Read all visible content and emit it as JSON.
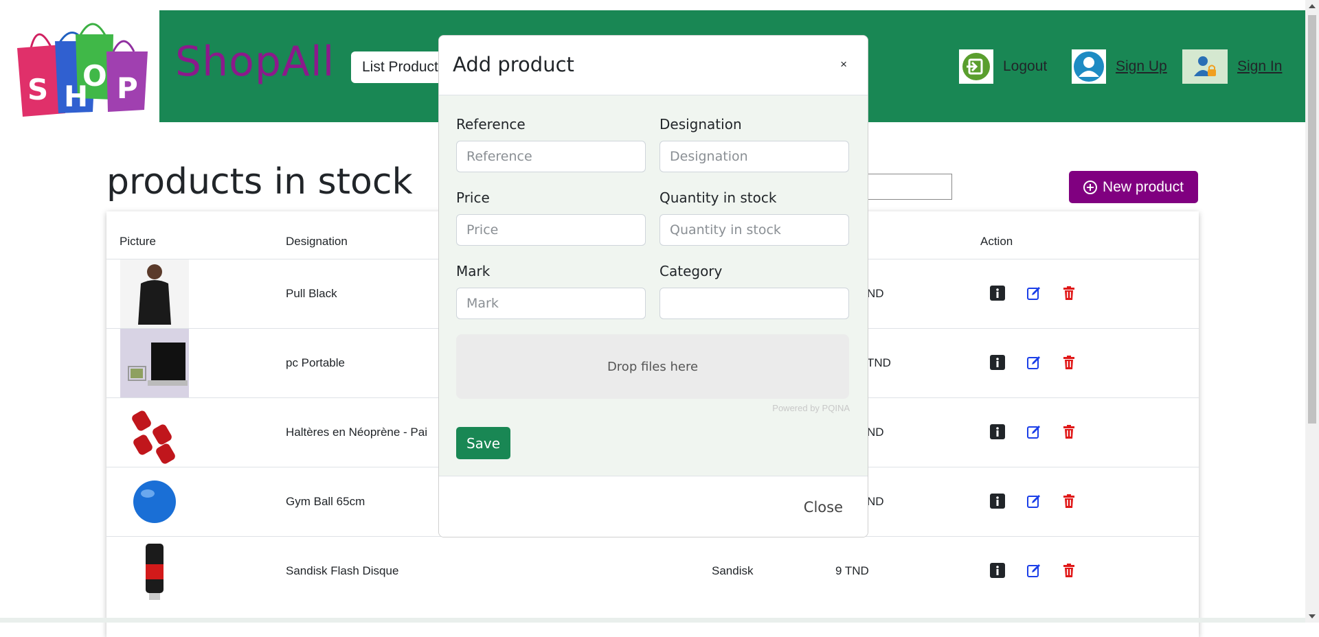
{
  "header": {
    "brand": "ShopAll",
    "nav_list_products": "List Products",
    "logout": "Logout",
    "sign_up": "Sign Up",
    "sign_in": "Sign In",
    "colors": {
      "header_bg": "#198754",
      "brand": "#8b1a8b"
    }
  },
  "main": {
    "title": "products in stock",
    "new_product": "New product",
    "table": {
      "headers": {
        "picture": "Picture",
        "designation": "Designation",
        "action": "Action"
      },
      "rows": [
        {
          "designation": "Pull Black",
          "mark": "",
          "price": "ND",
          "image": "woman-black-sweater"
        },
        {
          "designation": "pc Portable",
          "mark": "",
          "price": "TND",
          "image": "laptop-cart"
        },
        {
          "designation": "Haltères en Néoprène - Pai",
          "mark": "",
          "price": "ND",
          "image": "red-dumbbells"
        },
        {
          "designation": "Gym Ball 65cm",
          "mark": "",
          "price": "ND",
          "image": "blue-gym-ball"
        },
        {
          "designation": "Sandisk Flash Disque",
          "mark": "Sandisk",
          "price": "9 TND",
          "image": "usb-flash-drive"
        }
      ]
    }
  },
  "modal": {
    "title": "Add product",
    "close_x": "×",
    "fields": {
      "reference": {
        "label": "Reference",
        "placeholder": "Reference"
      },
      "designation": {
        "label": "Designation",
        "placeholder": "Designation"
      },
      "price": {
        "label": "Price",
        "placeholder": "Price"
      },
      "quantity": {
        "label": "Quantity in stock",
        "placeholder": "Quantity in stock"
      },
      "mark": {
        "label": "Mark",
        "placeholder": "Mark"
      },
      "category": {
        "label": "Category",
        "placeholder": ""
      }
    },
    "dropzone": "Drop files here",
    "powered_by": "Powered by PQINA",
    "save": "Save",
    "close": "Close"
  }
}
